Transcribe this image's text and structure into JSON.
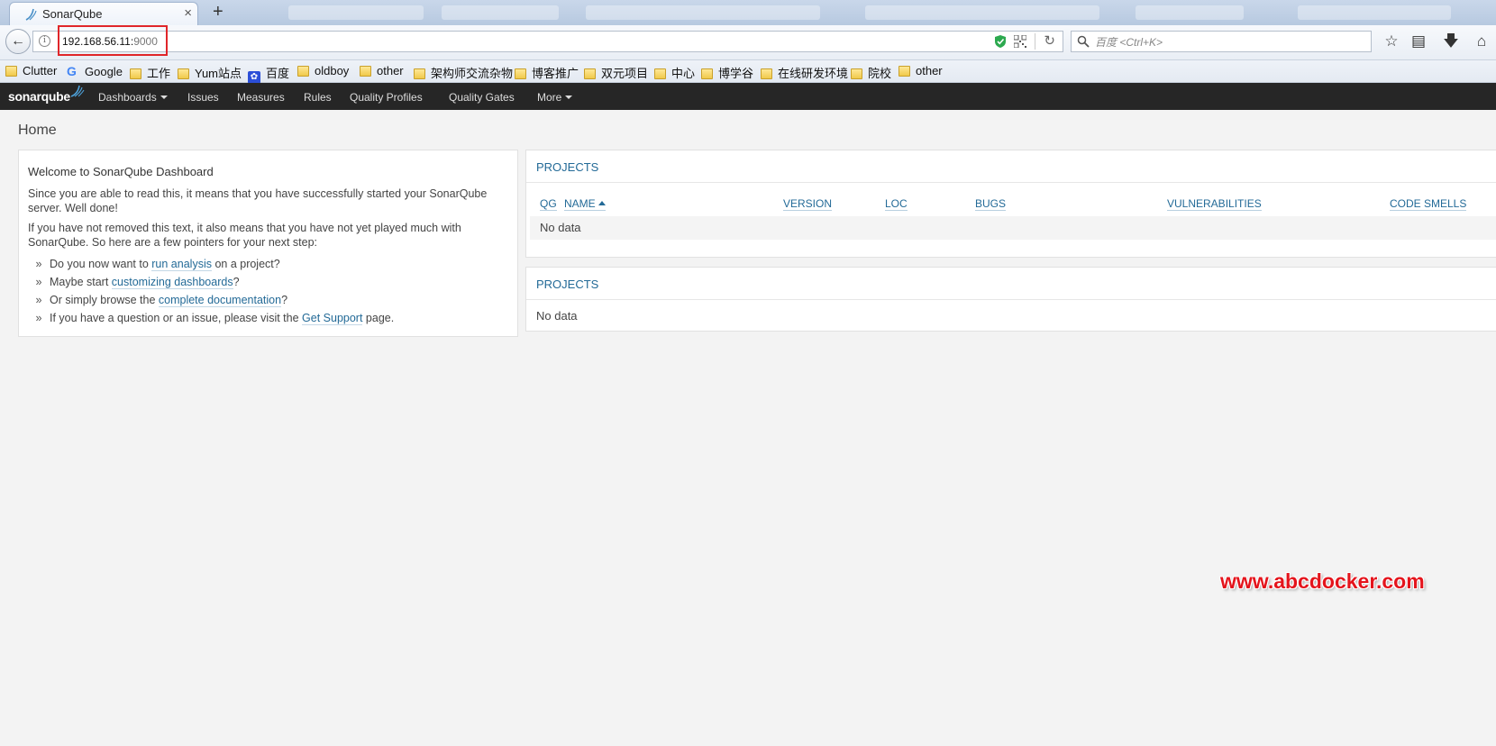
{
  "browser": {
    "tab_title": "SonarQube",
    "tab_close": "×",
    "new_tab": "+",
    "url_host": "192.168.56.11:",
    "url_port": "9000",
    "search_placeholder": "百度 <Ctrl+K>",
    "bookmarks": [
      {
        "label": "Clutter",
        "icon": "folder"
      },
      {
        "label": "Google",
        "icon": "google"
      },
      {
        "label": "工作",
        "icon": "folder"
      },
      {
        "label": "Yum站点",
        "icon": "folder"
      },
      {
        "label": "百度",
        "icon": "baidu"
      },
      {
        "label": "oldboy",
        "icon": "folder"
      },
      {
        "label": "other",
        "icon": "folder"
      },
      {
        "label": "架构师交流杂物",
        "icon": "folder"
      },
      {
        "label": "博客推广",
        "icon": "folder"
      },
      {
        "label": "双元项目",
        "icon": "folder"
      },
      {
        "label": "中心",
        "icon": "folder"
      },
      {
        "label": "博学谷",
        "icon": "folder"
      },
      {
        "label": "在线研发环境",
        "icon": "folder"
      },
      {
        "label": "院校",
        "icon": "folder"
      },
      {
        "label": "other",
        "icon": "folder"
      }
    ]
  },
  "sonar_nav": {
    "logo": "sonarqube",
    "items": [
      "Dashboards",
      "Issues",
      "Measures",
      "Rules",
      "Quality Profiles",
      "Quality Gates",
      "More"
    ]
  },
  "page": {
    "title": "Home"
  },
  "welcome": {
    "title": "Welcome to SonarQube Dashboard",
    "para1": "Since you are able to read this, it means that you have successfully started your SonarQube server. Well done!",
    "para2": "If you have not removed this text, it also means that you have not yet played much with SonarQube. So here are a few pointers for your next step:",
    "bullet": "»",
    "items": [
      {
        "before": "Do you now want to ",
        "link": "run analysis",
        "after": " on a project?"
      },
      {
        "before": "Maybe start ",
        "link": "customizing dashboards",
        "after": "?"
      },
      {
        "before": "Or simply browse the ",
        "link": "complete documentation",
        "after": "?"
      },
      {
        "before": "If you have a question or an issue, please visit the ",
        "link": "Get Support",
        "after": " page."
      }
    ]
  },
  "projects_table": {
    "heading": "PROJECTS",
    "columns": [
      "QG",
      "NAME",
      "VERSION",
      "LOC",
      "BUGS",
      "VULNERABILITIES",
      "CODE SMELLS"
    ],
    "empty_text": "No data"
  },
  "projects_widget": {
    "heading": "PROJECTS",
    "empty_text": "No data"
  },
  "watermark": "www.abcdocker.com",
  "colors": {
    "link": "#236a97",
    "nav_bg": "#262626",
    "highlight_box": "#e0262a",
    "watermark": "#e4141c"
  }
}
